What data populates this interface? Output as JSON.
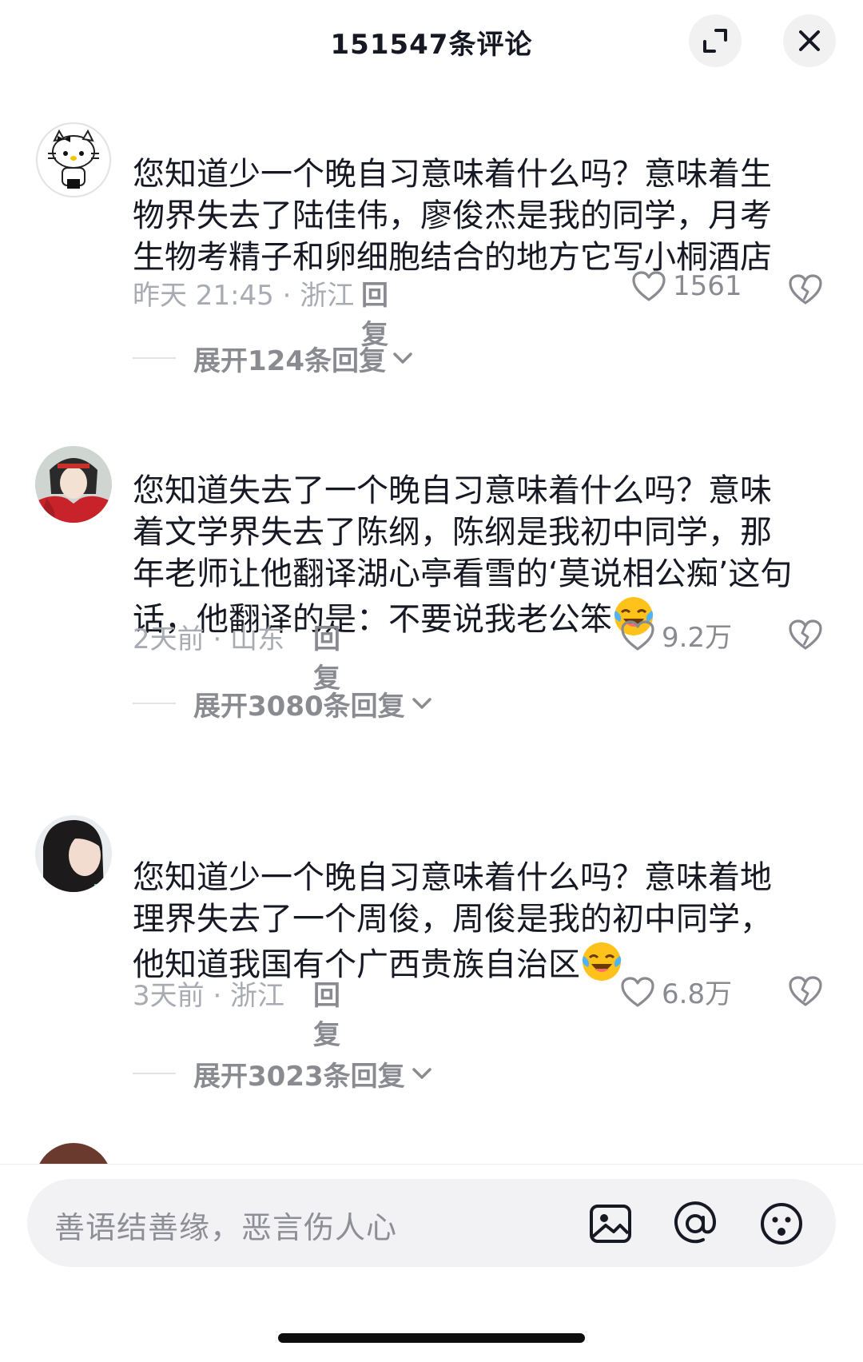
{
  "header": {
    "title": "151547条评论",
    "expand_icon": "expand-icon",
    "close_icon": "close-icon"
  },
  "comments": [
    {
      "text": "您知道少一个晚自习意味着什么吗？意味着生物界失去了陆佳伟，廖俊杰是我的同学，月考生物考精子和卵细胞结合的地方它写小桐酒店",
      "lines": [
        "您知道少一个晚自习意味着什么吗？意味着生",
        "物界失去了陆佳伟，廖俊杰是我的同学，月考",
        "生物考精子和卵细胞结合的地方它写小桐酒店"
      ],
      "meta": "昨天 21:45 · 浙江",
      "reply_label": "回复",
      "likes": "1561",
      "expand_label": "展开124条回复"
    },
    {
      "text": "您知道失去了一个晚自习意味着什么吗？意味着文学界失去了陈纲，陈纲是我初中同学，那年老师让他翻译湖心亭看雪的‘莫说相公痴’这句话，他翻译的是：不要说我老公笨",
      "lines": [
        "您知道失去了一个晚自习意味着什么吗？意味",
        "着文学界失去了陈纲，陈纲是我初中同学，那",
        "年老师让他翻译湖心亭看雪的‘莫说相公痴’这句",
        "话，他翻译的是：不要说我老公笨"
      ],
      "meta": "2天前 · 山东",
      "reply_label": "回复",
      "likes": "9.2万",
      "expand_label": "展开3080条回复"
    },
    {
      "text": "您知道少一个晚自习意味着什么吗？意味着地理界失去了一个周俊，周俊是我的初中同学，他知道我国有个广西贵族自治区",
      "lines": [
        "您知道少一个晚自习意味着什么吗？意味着地",
        "理界失去了一个周俊，周俊是我的初中同学，",
        "他知道我国有个广西贵族自治区"
      ],
      "meta": "3天前 · 浙江",
      "reply_label": "回复",
      "likes": "6.8万",
      "expand_label": "展开3023条回复"
    }
  ],
  "input": {
    "placeholder": "善语结善缘，恶言伤人心",
    "icons": [
      "image-icon",
      "at-icon",
      "emoji-icon"
    ]
  },
  "colors": {
    "background": "#ffffff",
    "text": "#161823",
    "muted": "#8a8b91",
    "input_bg": "#f2f2f4"
  }
}
